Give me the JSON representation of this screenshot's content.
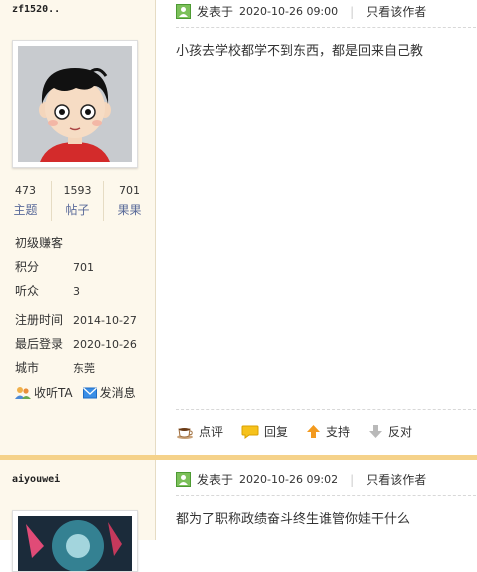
{
  "post1": {
    "user": {
      "name": "zf1520..",
      "stats": [
        {
          "value": "473",
          "label": "主题"
        },
        {
          "value": "1593",
          "label": "帖子"
        },
        {
          "value": "701",
          "label": "果果"
        }
      ],
      "rank": "初级赚客",
      "info": [
        {
          "key": "积分",
          "value": "701"
        },
        {
          "key": "听众",
          "value": "3"
        },
        {
          "key": "注册时间",
          "value": "2014-10-27"
        },
        {
          "key": "最后登录",
          "value": "2020-10-26"
        },
        {
          "key": "城市",
          "value": "东莞"
        }
      ],
      "follow_label": "收听TA",
      "message_label": "发消息"
    },
    "posted_label": "发表于",
    "date": "2020-10-26 09:00",
    "author_only": "只看该作者",
    "content": "小孩去学校都学不到东西，都是回来自己教",
    "actions": {
      "review": "点评",
      "reply": "回复",
      "support": "支持",
      "oppose": "反对"
    }
  },
  "post2": {
    "user": {
      "name": "aiyouwei"
    },
    "posted_label": "发表于",
    "date": "2020-10-26 09:02",
    "author_only": "只看该作者",
    "content": "都为了职称政绩奋斗终生谁管你娃干什么"
  }
}
